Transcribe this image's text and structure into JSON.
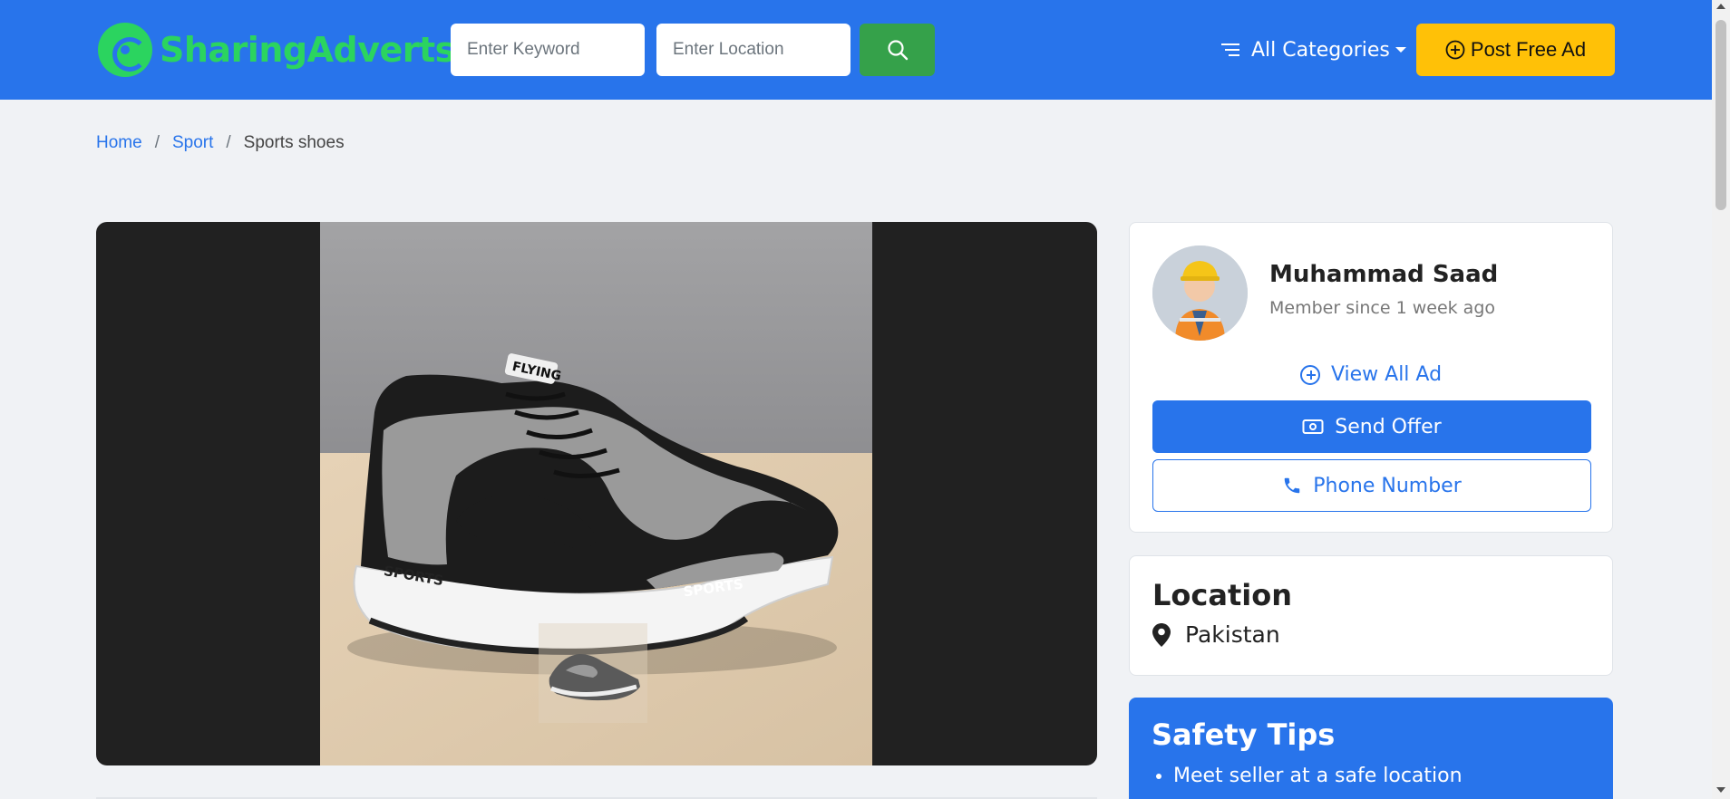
{
  "brand": {
    "name_part1": "Sharing",
    "name_part2": "Adverts",
    "accent": "#2bd45f"
  },
  "header": {
    "bg": "#2874eb",
    "keyword_placeholder": "Enter Keyword",
    "location_placeholder": "Enter Location",
    "search_icon": "search-icon",
    "categories_label": "All Categories",
    "post_ad_label": "Post Free Ad"
  },
  "breadcrumb": [
    {
      "label": "Home"
    },
    {
      "label": "Sport"
    },
    {
      "label": "Sports shoes"
    }
  ],
  "gallery": {
    "image_alt": "sports shoe",
    "shoe_brand_text": "FLYING",
    "shoe_side_text": "SPORTS"
  },
  "seller": {
    "name": "Muhammad Saad",
    "member_since": "Member since 1 week ago",
    "view_all_label": "View All Ad",
    "send_offer_label": "Send Offer",
    "phone_label": "Phone Number"
  },
  "location": {
    "title": "Location",
    "value": "Pakistan"
  },
  "safety": {
    "title": "Safety Tips",
    "tips": [
      "Meet seller at a safe location"
    ]
  }
}
